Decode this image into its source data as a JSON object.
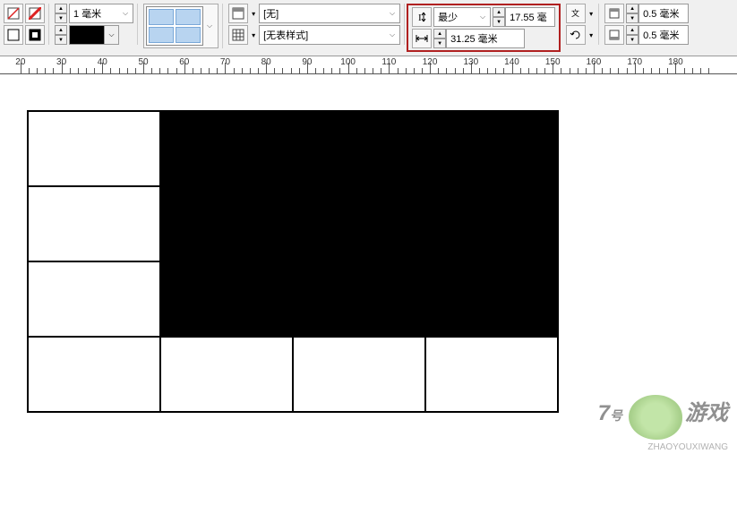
{
  "toolbar": {
    "stroke_weight": {
      "value": "1 毫米"
    },
    "color_swatch": "#000000",
    "char_style_dropdown": {
      "value": "[无]"
    },
    "table_style_dropdown": {
      "value": "[无表样式]"
    },
    "row_mode_dropdown": {
      "value": "最少"
    },
    "row_height_input": {
      "value": "17.55 毫"
    },
    "col_width_input": {
      "value": "31.25 毫米"
    },
    "inset_top": {
      "value": "0.5 毫米"
    },
    "inset_bottom": {
      "value": "0.5 毫米"
    }
  },
  "ruler": {
    "start": 20,
    "end": 180,
    "step": 10,
    "unit": ""
  },
  "table": {
    "rows": 4,
    "cols": 4,
    "cells": [
      [
        "white",
        "black",
        "black",
        "black"
      ],
      [
        "white",
        "black",
        "black",
        "black"
      ],
      [
        "white",
        "black",
        "black",
        "black"
      ],
      [
        "white",
        "white",
        "white",
        "white"
      ]
    ]
  },
  "watermark": {
    "brand_num": "7",
    "brand_suffix": "号",
    "brand_text": "游戏",
    "sub": "ZHAOYOUXIWANG"
  }
}
